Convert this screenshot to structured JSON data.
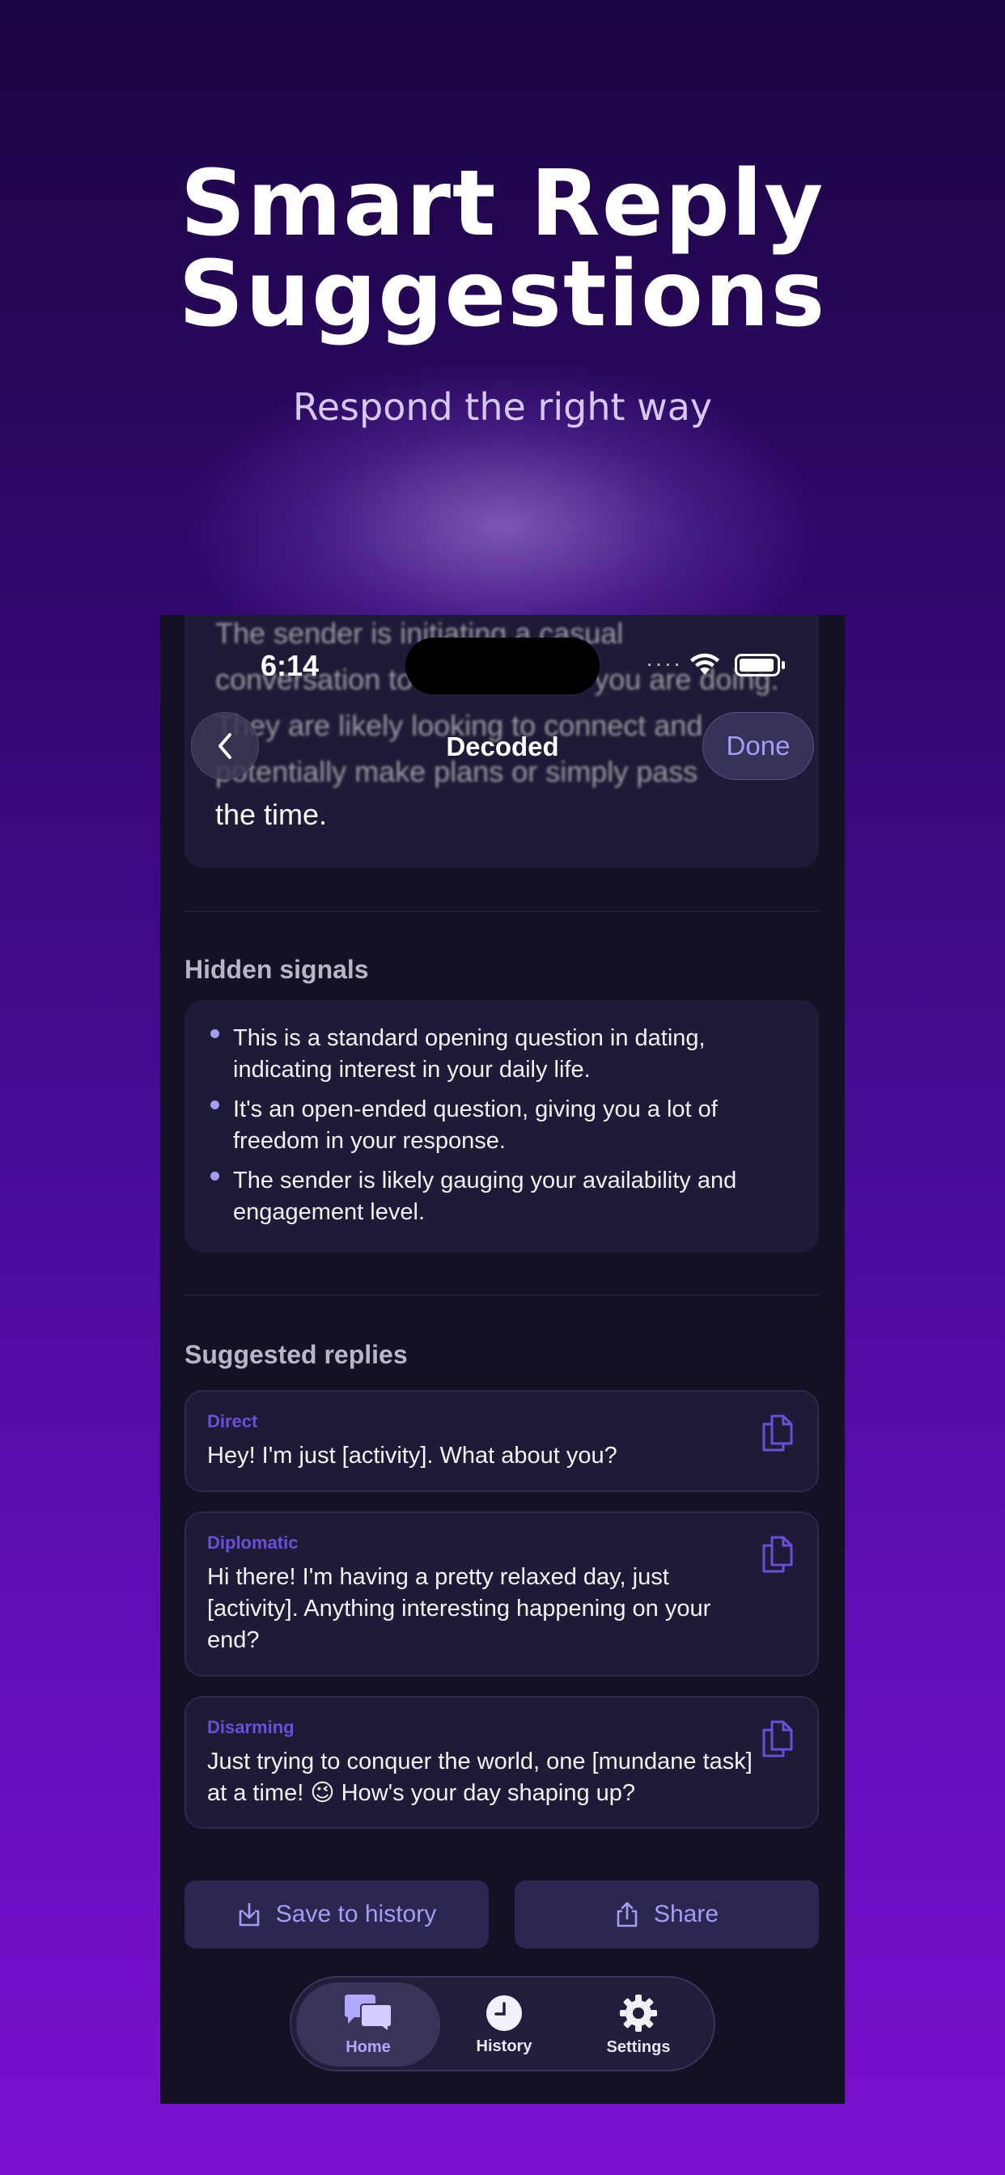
{
  "hero": {
    "title_line1": "Smart Reply",
    "title_line2": "Suggestions",
    "subtitle": "Respond the right way"
  },
  "status_bar": {
    "time": "6:14"
  },
  "nav": {
    "title": "Decoded",
    "done_label": "Done"
  },
  "summary": {
    "lines": [
      "The sender is initiating a casual",
      "conversation to find out what you are doing.",
      "They are likely looking to connect and",
      "potentially make plans or simply pass",
      "the time."
    ]
  },
  "hidden_signals": {
    "title": "Hidden signals",
    "items": [
      "This is a standard opening question in dating, indicating interest in your daily life.",
      "It's an open-ended question, giving you a lot of freedom in your response.",
      "The sender is likely gauging your availability and engagement level."
    ]
  },
  "suggested_replies": {
    "title": "Suggested replies",
    "items": [
      {
        "type": "Direct",
        "text": "Hey! I'm just [activity]. What about you?"
      },
      {
        "type": "Diplomatic",
        "text": "Hi there! I'm having a pretty relaxed day, just [activity]. Anything interesting happening on your end?"
      },
      {
        "type": "Disarming",
        "text": "Just trying to conquer the world, one [mundane task] at a time! 😉 How's your day shaping up?"
      }
    ]
  },
  "actions": {
    "save_label": "Save to history",
    "share_label": "Share"
  },
  "tabs": [
    {
      "label": "Home",
      "icon": "chat-bubbles-icon",
      "active": true
    },
    {
      "label": "History",
      "icon": "clock-icon",
      "active": false
    },
    {
      "label": "Settings",
      "icon": "gear-icon",
      "active": false
    }
  ],
  "colors": {
    "accent": "#a79cf5",
    "reply_type": "#6a4fd8",
    "card": "#1f1a35",
    "phone_bg": "#141025"
  }
}
